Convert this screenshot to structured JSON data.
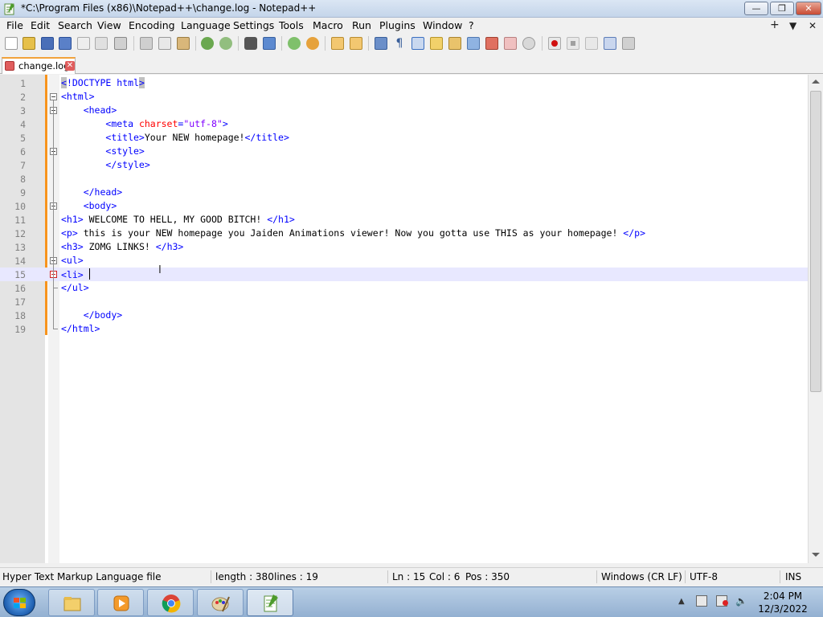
{
  "window": {
    "title": "*C:\\Program Files (x86)\\Notepad++\\change.log - Notepad++",
    "icon": "notepadpp-icon"
  },
  "window_controls": {
    "minimize": "—",
    "maximize": "❐",
    "close": "✕"
  },
  "menu": {
    "items": [
      "File",
      "Edit",
      "Search",
      "View",
      "Encoding",
      "Language",
      "Settings",
      "Tools",
      "Macro",
      "Run",
      "Plugins",
      "Window",
      "?"
    ],
    "right": [
      "+",
      "▼",
      "✕"
    ]
  },
  "toolbar": {
    "icons": [
      "new-file-icon",
      "open-file-icon",
      "save-icon",
      "save-all-icon",
      "close-icon",
      "close-all-icon",
      "print-icon",
      "cut-icon",
      "copy-icon",
      "paste-icon",
      "undo-icon",
      "redo-icon",
      "find-icon",
      "replace-icon",
      "zoom-in-icon",
      "zoom-out-icon",
      "sync-vertical-icon",
      "sync-horizontal-icon",
      "word-wrap-icon",
      "show-all-chars-icon",
      "indent-guide-icon",
      "user-defined-lang-icon",
      "doc-map-icon",
      "doc-list-icon",
      "function-list-icon",
      "folder-workspace-icon",
      "monitoring-icon",
      "record-macro-icon",
      "stop-macro-icon",
      "play-macro-icon",
      "run-multiple-icon",
      "save-macro-icon"
    ]
  },
  "tabs": [
    {
      "label": "change.log",
      "active": true
    }
  ],
  "editor": {
    "lines": [
      {
        "n": "1",
        "html": "<span class=\"hl\"><span class=\"tag\">&lt;</span></span><span class=\"tag\">!DOCTYPE html</span><span class=\"hl\"><span class=\"tag\">&gt;</span></span>"
      },
      {
        "n": "2",
        "html": "<span class=\"tag\">&lt;html&gt;</span>"
      },
      {
        "n": "3",
        "html": "    <span class=\"tag\">&lt;head&gt;</span>"
      },
      {
        "n": "4",
        "html": "        <span class=\"tag\">&lt;meta </span><span class=\"attr\">charset</span><span class=\"tag\">=</span><span class=\"val\">\"utf-8\"</span><span class=\"tag\">&gt;</span>"
      },
      {
        "n": "5",
        "html": "        <span class=\"tag\">&lt;title&gt;</span><span class=\"txt\">Your NEW homepage!</span><span class=\"tag\">&lt;/title&gt;</span>"
      },
      {
        "n": "6",
        "html": "        <span class=\"tag\">&lt;style&gt;</span>"
      },
      {
        "n": "7",
        "html": "        <span class=\"tag\">&lt;/style&gt;</span>"
      },
      {
        "n": "8",
        "html": ""
      },
      {
        "n": "9",
        "html": "    <span class=\"tag\">&lt;/head&gt;</span>"
      },
      {
        "n": "10",
        "html": "    <span class=\"tag\">&lt;body&gt;</span>"
      },
      {
        "n": "11",
        "html": "<span class=\"tag\">&lt;h1&gt;</span><span class=\"txt\"> WELCOME TO HELL, MY GOOD BITCH! </span><span class=\"tag\">&lt;/h1&gt;</span>"
      },
      {
        "n": "12",
        "html": "<span class=\"tag\">&lt;p&gt;</span><span class=\"txt\"> this is your NEW homepage you Jaiden Animations viewer! Now you gotta use THIS as your homepage! </span><span class=\"tag\">&lt;/p&gt;</span>"
      },
      {
        "n": "13",
        "html": "<span class=\"tag\">&lt;h3&gt;</span><span class=\"txt\"> ZOMG LINKS! </span><span class=\"tag\">&lt;/h3&gt;</span>"
      },
      {
        "n": "14",
        "html": "<span class=\"tag\">&lt;ul&gt;</span>"
      },
      {
        "n": "15",
        "html": "<span class=\"tag\">&lt;li&gt;</span> <span class=\"caret\"></span>"
      },
      {
        "n": "16",
        "html": "<span class=\"tag\">&lt;/ul&gt;</span>"
      },
      {
        "n": "17",
        "html": ""
      },
      {
        "n": "18",
        "html": "    <span class=\"tag\">&lt;/body&gt;</span>"
      },
      {
        "n": "19",
        "html": "<span class=\"tag\">&lt;/html&gt;</span>"
      }
    ],
    "current_line": 15
  },
  "status": {
    "file_type": "Hyper Text Markup Language file",
    "length": "length : 380",
    "lines": "lines : 19",
    "ln": "Ln : 15",
    "col": "Col : 6",
    "pos": "Pos : 350",
    "eol": "Windows (CR LF)",
    "encoding": "UTF-8",
    "mode": "INS"
  },
  "taskbar": {
    "apps": [
      "explorer-icon",
      "media-player-icon",
      "chrome-icon",
      "paint-icon",
      "notepadpp-icon"
    ],
    "tray": [
      "show-hidden-icons-icon",
      "network-icon",
      "action-center-icon",
      "volume-icon"
    ],
    "time": "2:04 PM",
    "date": "12/3/2022"
  },
  "colors": {
    "tag": "#0000ff",
    "attribute": "#ff0000",
    "attribute_value": "#8000ff",
    "current_line": "#e8e8ff",
    "change_marker": "#f7941d"
  }
}
